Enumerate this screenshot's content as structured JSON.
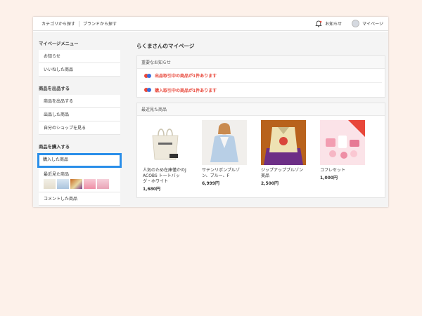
{
  "header": {
    "nav_categories": "カテゴリから探す",
    "nav_brands": "ブランドから探す",
    "notifications": "お知らせ",
    "mypage": "マイページ"
  },
  "sidebar": {
    "menu_title": "マイページメニュー",
    "menu_items": [
      "お知らせ",
      "いいねした商品"
    ],
    "sell_title": "商品を出品する",
    "sell_items": [
      "商品を出品する",
      "出品した商品",
      "自分のショップを見る"
    ],
    "buy_title": "商品を購入する",
    "purchased": "購入した商品",
    "recently_viewed": "最近見た商品",
    "commented": "コメントした商品"
  },
  "main": {
    "title": "らくまさんのマイページ",
    "notices_title": "重要なお知らせ",
    "notices": [
      "出品取引中の商品が1件あります",
      "購入取引中の商品が1件あります"
    ],
    "recent_title": "最近見た商品",
    "products": [
      {
        "name": "人気のため在庫僅かのJ ACOBS トートバッグ・ホワイト",
        "price": "1,680円"
      },
      {
        "name": "サテンリボンブルゾン、ブルー、F",
        "price": "6,999円"
      },
      {
        "name": "ジップアップブルゾン美品",
        "price": "2,500円"
      },
      {
        "name": "コフレセット",
        "price": "1,000円"
      }
    ]
  },
  "colors": {
    "accent": "#2a8ee9",
    "notice": "#e8473a",
    "background": "#fdf1ea"
  }
}
